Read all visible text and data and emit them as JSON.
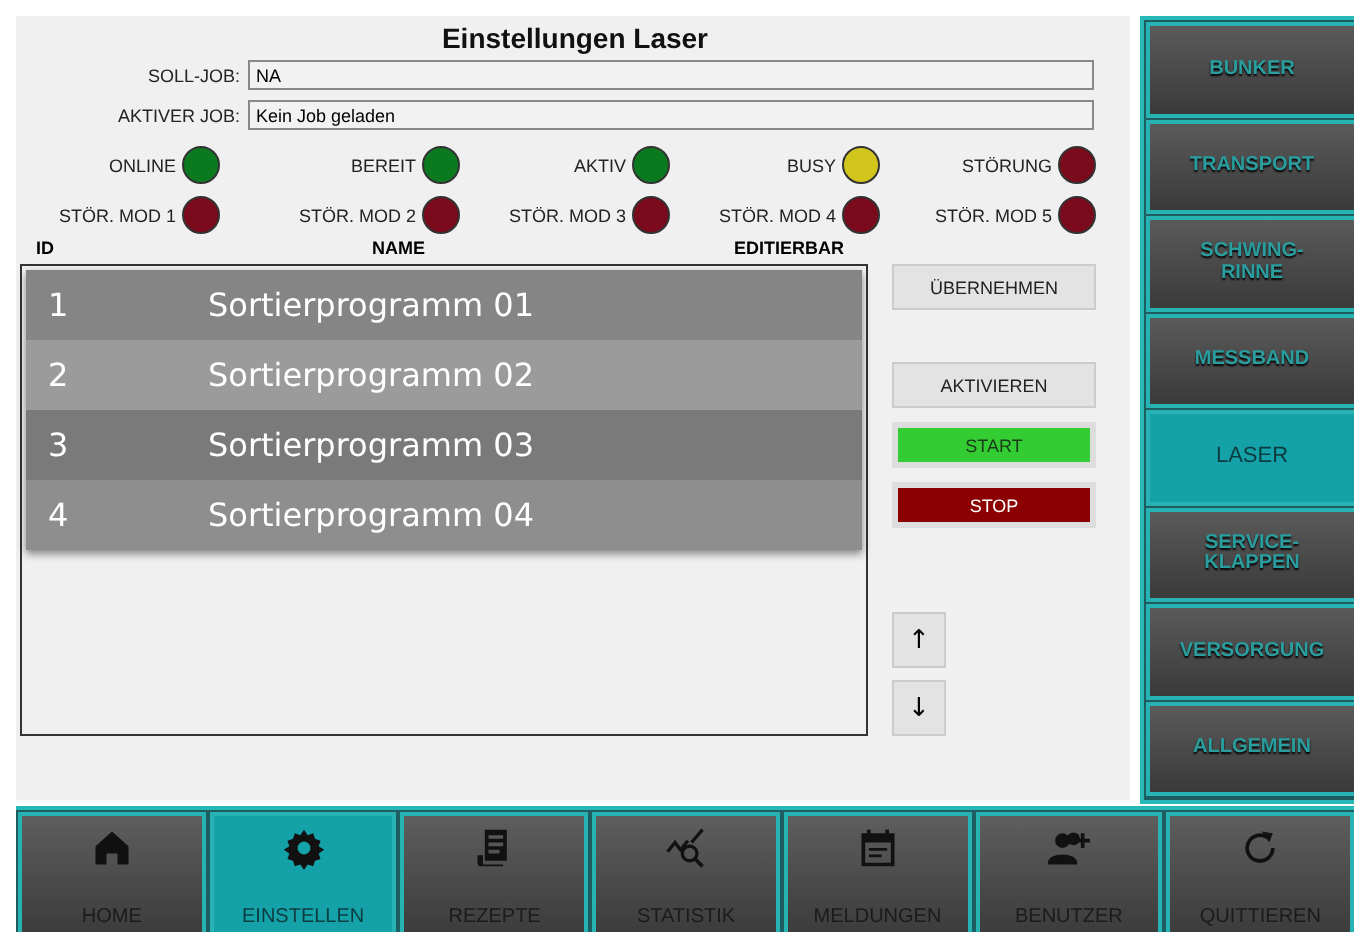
{
  "title": "Einstellungen Laser",
  "fields": [
    {
      "label": "SOLL-JOB:",
      "value": "NA"
    },
    {
      "label": "AKTIVER JOB:",
      "value": "Kein Job geladen"
    }
  ],
  "indicators": [
    {
      "label": "ONLINE",
      "color": "#0b7a1f"
    },
    {
      "label": "BEREIT",
      "color": "#0b7a1f"
    },
    {
      "label": "AKTIV",
      "color": "#0b7a1f"
    },
    {
      "label": "BUSY",
      "color": "#d2c61c"
    },
    {
      "label": "STÖRUNG",
      "color": "#7a0a1c"
    },
    {
      "label": "STÖR. MOD 1",
      "color": "#7a0a1c"
    },
    {
      "label": "STÖR. MOD 2",
      "color": "#7a0a1c"
    },
    {
      "label": "STÖR. MOD 3",
      "color": "#7a0a1c"
    },
    {
      "label": "STÖR. MOD 4",
      "color": "#7a0a1c"
    },
    {
      "label": "STÖR. MOD 5",
      "color": "#7a0a1c"
    }
  ],
  "table": {
    "columns": [
      "ID",
      "NAME",
      "EDITIERBAR"
    ],
    "rows": [
      {
        "id": "1",
        "name": "Sortierprogramm 01"
      },
      {
        "id": "2",
        "name": "Sortierprogramm 02"
      },
      {
        "id": "3",
        "name": "Sortierprogramm 03"
      },
      {
        "id": "4",
        "name": "Sortierprogramm 04"
      }
    ]
  },
  "actions": [
    {
      "label": "ÜBERNEHMEN",
      "kind": "plain"
    },
    {
      "label": "AKTIVIEREN",
      "kind": "plain"
    },
    {
      "label": "START",
      "kind": "start"
    },
    {
      "label": "STOP",
      "kind": "stop"
    }
  ],
  "move_buttons": [
    "↑",
    "↓"
  ],
  "sidebar": {
    "items": [
      {
        "label": "BUNKER",
        "selected": false
      },
      {
        "label": "TRANSPORT",
        "selected": false
      },
      {
        "label": "SCHWING-\nRINNE",
        "selected": false
      },
      {
        "label": "MESSBAND",
        "selected": false
      },
      {
        "label": "LASER",
        "selected": true
      },
      {
        "label": "SERVICE-\nKLAPPEN",
        "selected": false
      },
      {
        "label": "VERSORGUNG",
        "selected": false
      },
      {
        "label": "ALLGEMEIN",
        "selected": false
      }
    ]
  },
  "bottom_nav": [
    {
      "label": "HOME",
      "selected": false
    },
    {
      "label": "EINSTELLEN",
      "selected": true
    },
    {
      "label": "REZEPTE",
      "selected": false
    },
    {
      "label": "STATISTIK",
      "selected": false
    },
    {
      "label": "MELDUNGEN",
      "selected": false
    },
    {
      "label": "BENUTZER",
      "selected": false
    },
    {
      "label": "QUITTIEREN",
      "selected": false
    }
  ]
}
